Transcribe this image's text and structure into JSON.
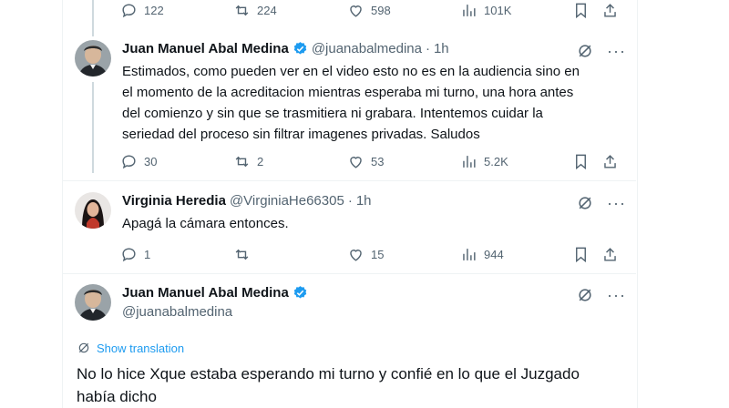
{
  "colors": {
    "accent": "#1d9bf0",
    "muted": "#536471",
    "text": "#0f1419"
  },
  "prev_tweet_actions": {
    "replies": "122",
    "reposts": "224",
    "likes": "598",
    "views": "101K"
  },
  "tweets": [
    {
      "name": "Juan Manuel Abal Medina",
      "handle": "@juanabalmedina",
      "sep": "·",
      "time": "1h",
      "verified": true,
      "lines": [
        "Estimados, como pueden ver en el video esto no es en la audiencia sino en",
        "el momento de la acreditacion mientras esperaba mi turno, una hora antes",
        "del comienzo y sin que se trasmitiera ni grabara. Intentemos cuidar la",
        "seriedad del proceso sin filtrar imagenes privadas. Saludos"
      ],
      "actions": {
        "replies": "30",
        "reposts": "2",
        "likes": "53",
        "views": "5.2K"
      }
    },
    {
      "name": "Virginia Heredia",
      "handle": "@VirginiaHe66305",
      "sep": "·",
      "time": "1h",
      "verified": false,
      "lines": [
        "Apagá la cámara entonces."
      ],
      "actions": {
        "replies": "1",
        "reposts": "",
        "likes": "15",
        "views": "944"
      }
    }
  ],
  "main_tweet": {
    "name": "Juan Manuel Abal Medina",
    "handle": "@juanabalmedina",
    "show_translation": "Show translation",
    "lines": [
      "No lo hice Xque estaba esperando mi turno y confié en lo que el Juzgado",
      "había dicho"
    ]
  },
  "icons": [
    "reply-icon",
    "repost-icon",
    "like-icon",
    "views-icon",
    "bookmark-icon",
    "share-icon",
    "grok-icon",
    "more-icon",
    "translate-icon",
    "verified-badge-icon"
  ]
}
